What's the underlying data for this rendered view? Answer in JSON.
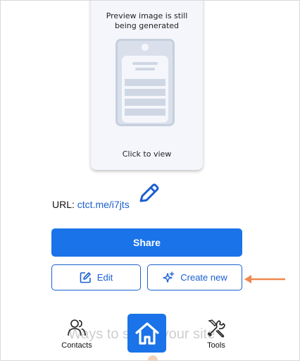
{
  "preview": {
    "message": "Preview image is still\nbeing generated",
    "click_label": "Click to view"
  },
  "url": {
    "label": "URL:",
    "link": "ctct.me/i7jts"
  },
  "actions": {
    "share_label": "Share",
    "edit_label": "Edit",
    "create_label": "Create new"
  },
  "background_text": "Ways to share your site",
  "nav": {
    "contacts_label": "Contacts",
    "tools_label": "Tools"
  },
  "colors": {
    "primary": "#1a73e8",
    "link": "#1a5fd0",
    "annotation_arrow": "#f0874d"
  },
  "icons": [
    "pencil-icon",
    "edit-icon",
    "sparkle-icon",
    "contacts-icon",
    "home-icon",
    "tools-icon",
    "arrow-icon"
  ]
}
